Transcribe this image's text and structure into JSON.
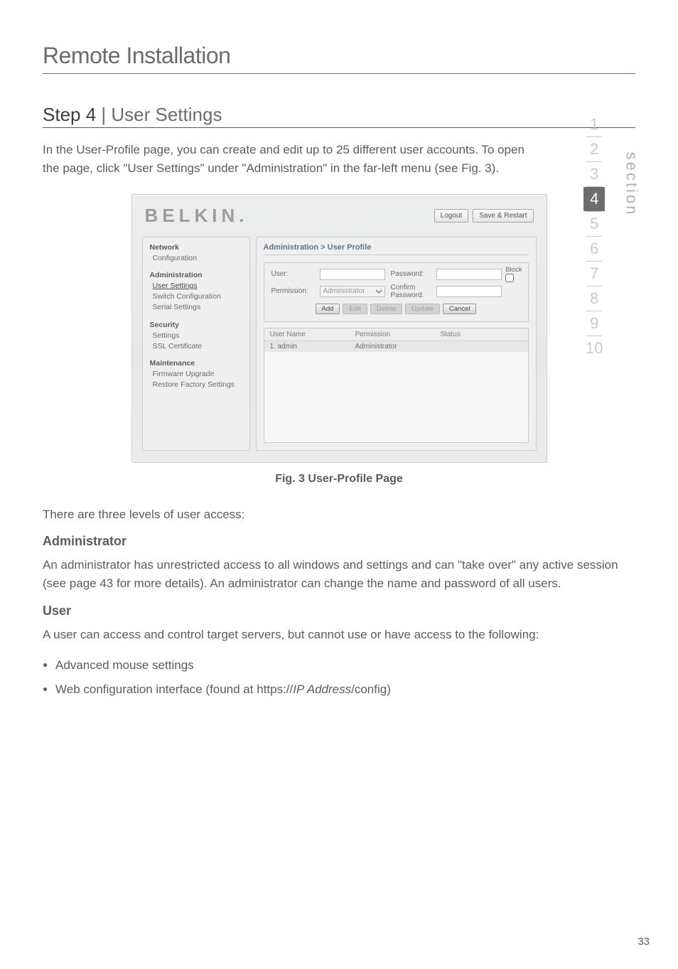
{
  "page": {
    "title": "Remote Installation",
    "step_heading_pre": "Step 4 ",
    "step_heading_sep": "| ",
    "step_heading_post": "User Settings",
    "intro": "In the User-Profile page, you can create and edit up to 25 different user accounts. To open the page, click \"User Settings\" under \"Administration\" in the far-left menu (see Fig. 3).",
    "fig_caption": "Fig. 3 User-Profile Page",
    "levels_text": "There are three levels of user access:",
    "admin_head": "Administrator",
    "admin_body": "An administrator has unrestricted access to all windows and settings and can \"take over\" any active session (see page 43 for more details). An administrator can change the name and password of all users.",
    "user_head": "User",
    "user_body": "A user can access and control target servers, but cannot use or have access to the following:",
    "bullets": {
      "b1": "Advanced mouse settings",
      "b2_pre": "Web configuration interface (found at https://",
      "b2_italic": "IP Address",
      "b2_post": "/config)"
    },
    "page_number": "33"
  },
  "nav": {
    "section_label": "section",
    "items": [
      "1",
      "2",
      "3",
      "4",
      "5",
      "6",
      "7",
      "8",
      "9",
      "10"
    ],
    "active": "4"
  },
  "screenshot": {
    "brand": "BELKIN.",
    "logout": "Logout",
    "save_restart": "Save & Restart",
    "sidebar": {
      "network": {
        "head": "Network",
        "items": [
          "Configuration"
        ]
      },
      "admin": {
        "head": "Administration",
        "items": [
          "User Settings",
          "Switch Configuration",
          "Serial Settings"
        ]
      },
      "security": {
        "head": "Security",
        "items": [
          "Settings",
          "SSL Certificate"
        ]
      },
      "maintenance": {
        "head": "Maintenance",
        "items": [
          "Firmware Upgrade",
          "Restore Factory Settings"
        ]
      }
    },
    "panel": {
      "title": "Administration > User Profile",
      "user_label": "User:",
      "permission_label": "Permission:",
      "permission_value": "Administrator",
      "password_label": "Password:",
      "confirm_label": "Confirm Password:",
      "block_label": "Block",
      "buttons": {
        "add": "Add",
        "edit": "Edit",
        "delete": "Delete",
        "update": "Update",
        "cancel": "Cancel"
      },
      "table": {
        "headers": {
          "user": "User Name",
          "perm": "Permission",
          "stat": "Status"
        },
        "row1": {
          "user": "1. admin",
          "perm": "Administrator",
          "stat": ""
        }
      }
    }
  }
}
